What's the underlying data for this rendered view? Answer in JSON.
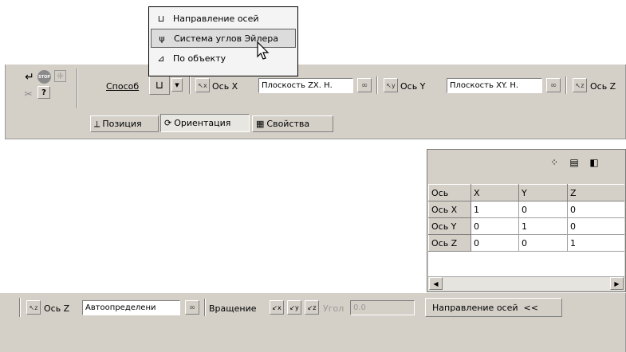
{
  "method_label": "Способ",
  "dropdown_menu": {
    "items": [
      {
        "label": "Направление осей",
        "icon": "axes-direction-icon"
      },
      {
        "label": "Система углов Эйлера",
        "icon": "euler-angles-icon"
      },
      {
        "label": "По объекту",
        "icon": "by-object-icon"
      }
    ]
  },
  "toolbar1": {
    "axis_x_label": "Ось X",
    "zx_plane_value": "Плоскость ZX. Н.",
    "axis_y_label": "Ось Y",
    "xy_plane_value": "Плоскость XY. Н.",
    "axis_z_label": "Ось Z"
  },
  "tabs": [
    {
      "label": "Позиция",
      "icon": "position-icon"
    },
    {
      "label": "Ориентация",
      "icon": "orientation-icon"
    },
    {
      "label": "Свойства",
      "icon": "properties-icon"
    }
  ],
  "matrix": {
    "headers": [
      "Ось",
      "X",
      "Y",
      "Z"
    ],
    "rows": [
      [
        "Ось X",
        "1",
        "0",
        "0"
      ],
      [
        "Ось Y",
        "0",
        "1",
        "0"
      ],
      [
        "Ось Z",
        "0",
        "0",
        "1"
      ]
    ]
  },
  "toolbar2": {
    "axis_z_label": "Ось Z",
    "auto_value": "Автоопределени",
    "rotation_label": "Вращение",
    "angle_label": "Угол",
    "angle_value": "0.0",
    "direction_button": "Направление осей  <<"
  }
}
